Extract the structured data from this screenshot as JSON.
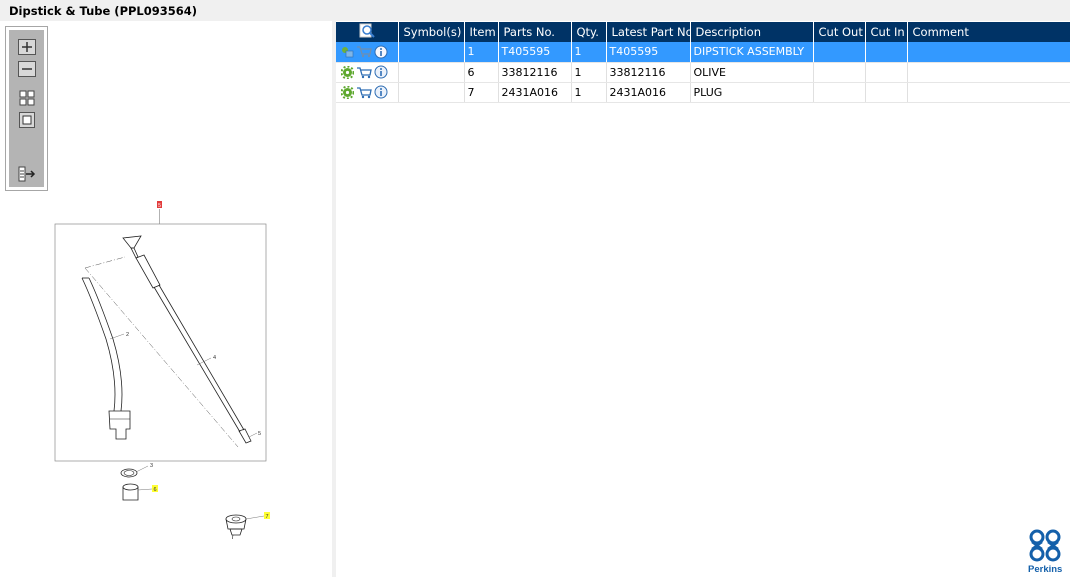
{
  "window": {
    "title": "Dipstick & Tube (PPL093564)"
  },
  "toolbar": {
    "buttons": [
      {
        "name": "zoom-in",
        "icon": "plus-box-icon"
      },
      {
        "name": "zoom-out",
        "icon": "minus-box-icon"
      },
      {
        "name": "fit-all",
        "icon": "grid-icon"
      },
      {
        "name": "fit-window",
        "icon": "square-icon"
      },
      {
        "name": "export",
        "icon": "list-arrow-icon"
      }
    ]
  },
  "drawing": {
    "callouts": {
      "top_marker": "5",
      "item2": "2",
      "item3": "3",
      "item4": "4",
      "item5": "5",
      "item6": "6",
      "item7": "7"
    },
    "highlight_color": "#ffff33",
    "marker_color": "#e23c3c"
  },
  "table": {
    "columns": {
      "icon_col": "search-doc-icon",
      "symbols": "Symbol(s)",
      "item": "Item",
      "parts_no": "Parts No.",
      "qty": "Qty.",
      "latest": "Latest Part No.",
      "description": "Description",
      "cut_out": "Cut Out",
      "cut_in": "Cut In",
      "comment": "Comment"
    },
    "rows": [
      {
        "item": "1",
        "parts_no": "T405595",
        "qty": "1",
        "latest": "T405595",
        "description": "DIPSTICK ASSEMBLY",
        "cut_out": "",
        "cut_in": "",
        "comment": "",
        "selected": true
      },
      {
        "item": "6",
        "parts_no": "33812116",
        "qty": "1",
        "latest": "33812116",
        "description": "OLIVE",
        "cut_out": "",
        "cut_in": "",
        "comment": "",
        "selected": false
      },
      {
        "item": "7",
        "parts_no": "2431A016",
        "qty": "1",
        "latest": "2431A016",
        "description": "PLUG",
        "cut_out": "",
        "cut_in": "",
        "comment": "",
        "selected": false
      }
    ],
    "header_color": "#003366",
    "selected_color": "#3399ff"
  },
  "brand": {
    "name": "Perkins",
    "color": "#1460aa"
  }
}
